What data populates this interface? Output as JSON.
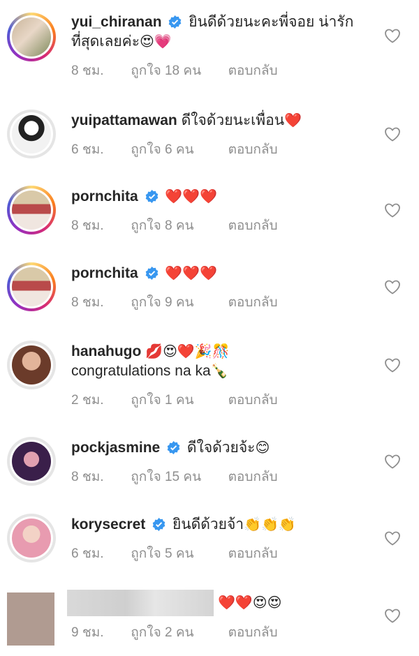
{
  "comments": [
    {
      "username": "yui_chiranan",
      "verified": true,
      "text": "ยินดีด้วยนะคะพี่จอย น่ารักที่สุดเลยค่ะ",
      "emojis": "😍💗",
      "time": "8 ชม.",
      "likes": "ถูกใจ 18 คน",
      "reply": "ตอบกลับ"
    },
    {
      "username": "yuipattamawan",
      "verified": false,
      "text": "ดีใจด้วยนะเพื่อน",
      "emojis": "❤️",
      "time": "6 ชม.",
      "likes": "ถูกใจ 6 คน",
      "reply": "ตอบกลับ"
    },
    {
      "username": "pornchita",
      "verified": true,
      "text": "",
      "emojis": "❤️❤️❤️",
      "time": "8 ชม.",
      "likes": "ถูกใจ 8 คน",
      "reply": "ตอบกลับ"
    },
    {
      "username": "pornchita",
      "verified": true,
      "text": "",
      "emojis": "❤️❤️❤️",
      "time": "8 ชม.",
      "likes": "ถูกใจ 9 คน",
      "reply": "ตอบกลับ"
    },
    {
      "username": "hanahugo",
      "verified": false,
      "text": "congratulations na ka",
      "emojis": "💋😍❤️🎉🎊",
      "emojis2": "🍾",
      "time": "2 ชม.",
      "likes": "ถูกใจ 1 คน",
      "reply": "ตอบกลับ"
    },
    {
      "username": "pockjasmine",
      "verified": true,
      "text": "ดีใจด้วยจ้ะ",
      "emojis": "😊",
      "time": "8 ชม.",
      "likes": "ถูกใจ 15 คน",
      "reply": "ตอบกลับ"
    },
    {
      "username": "korysecret",
      "verified": true,
      "text": "ยินดีด้วยจ้า",
      "emojis": "👏👏👏",
      "time": "6 ชม.",
      "likes": "ถูกใจ 5 คน",
      "reply": "ตอบกลับ"
    },
    {
      "username": "",
      "verified": false,
      "text": "",
      "emojis": "❤️❤️😍😍",
      "time": "9 ชม.",
      "likes": "ถูกใจ 2 คน",
      "reply": "ตอบกลับ"
    }
  ],
  "icons": {
    "verified": "verified-badge-icon",
    "like": "heart-outline-icon"
  },
  "colors": {
    "verified": "#3897f0",
    "meta": "#8e8e8e",
    "text": "#262626",
    "heart": "#ed4956"
  }
}
